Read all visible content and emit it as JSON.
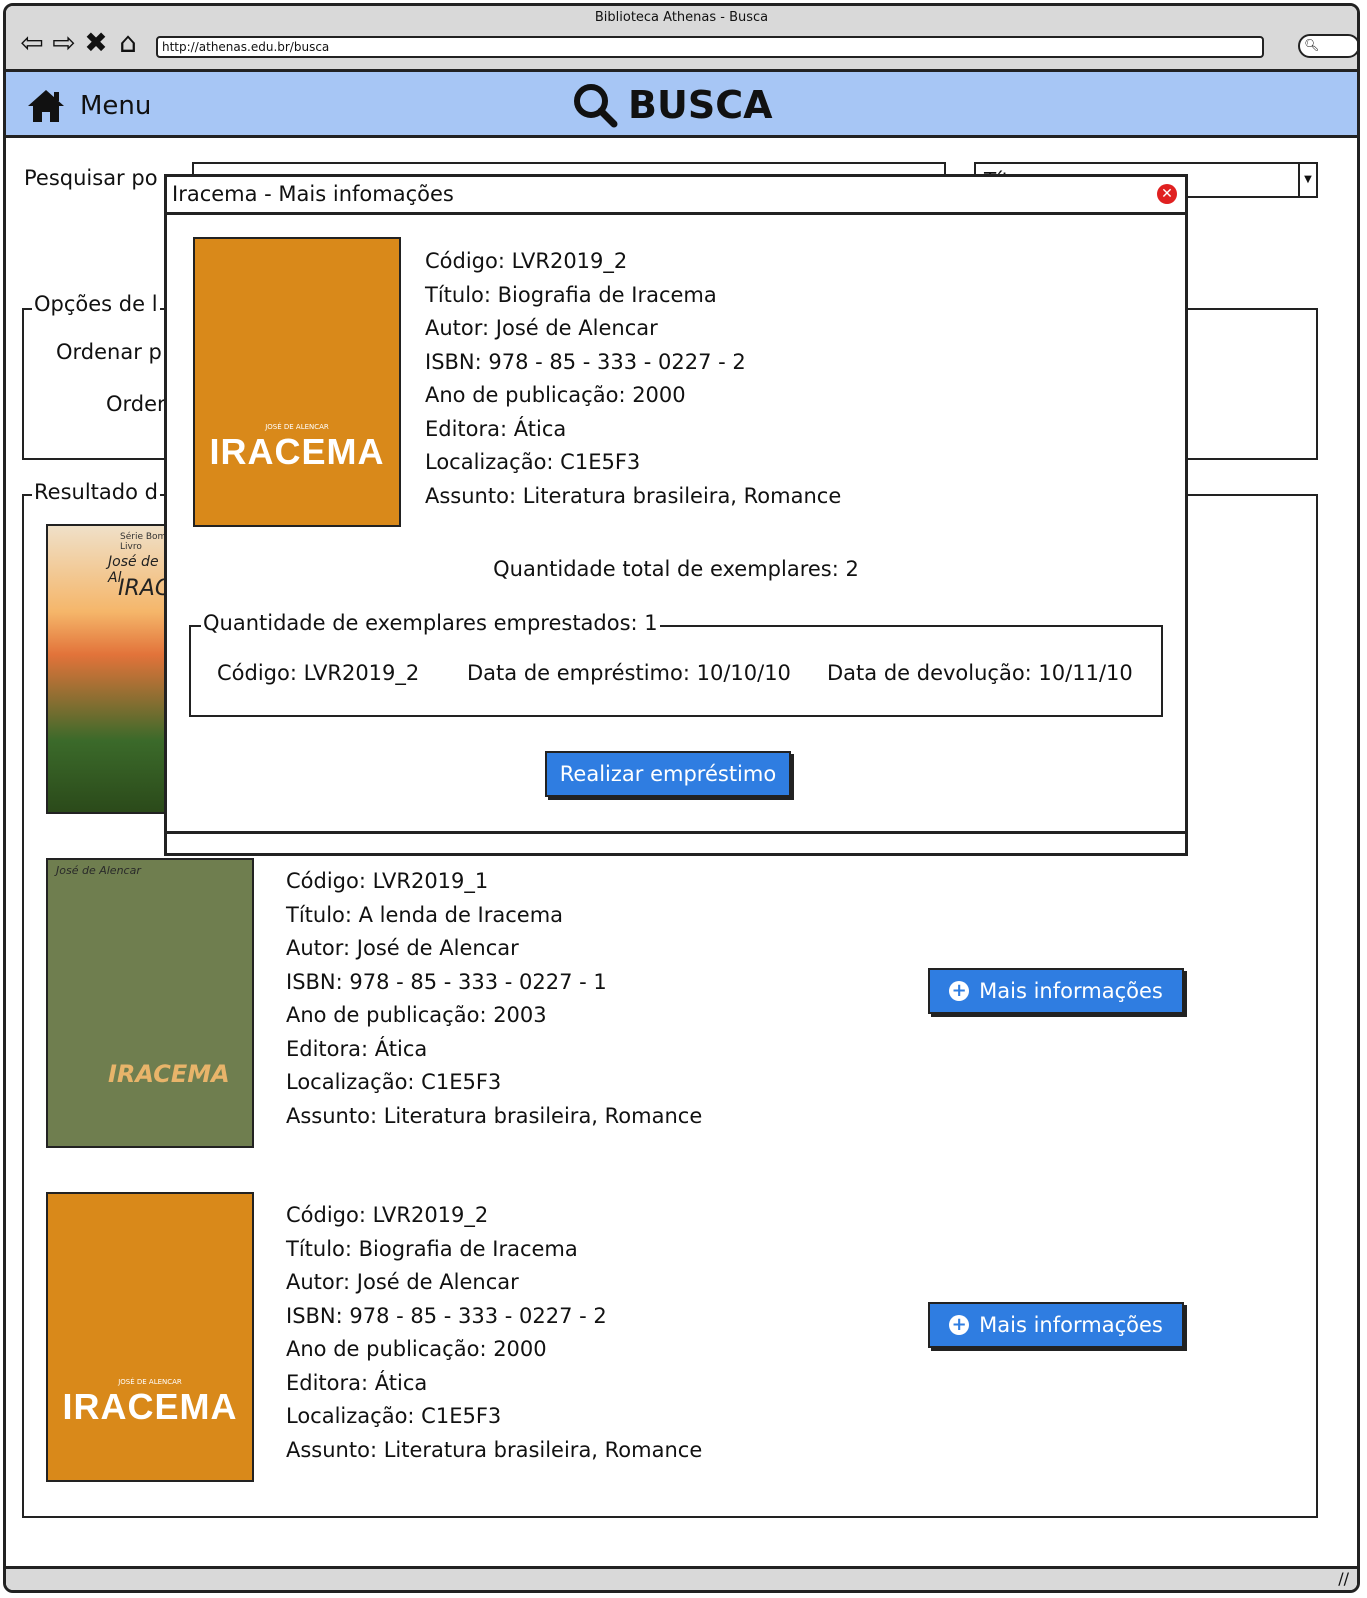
{
  "browser": {
    "title": "Biblioteca Athenas - Busca",
    "url": "http://athenas.edu.br/busca"
  },
  "header": {
    "menu_label": "Menu",
    "title": "BUSCA"
  },
  "search": {
    "label": "Pesquisar po",
    "select_value": "Tít"
  },
  "options": {
    "legend": "Opções de l",
    "order_by": "Ordenar p",
    "order": "Order"
  },
  "results": {
    "legend": "Resultado d",
    "items": [
      {
        "cover": {
          "series": "Série Bom Livro",
          "author": "José de Al",
          "title": "IRACE"
        }
      },
      {
        "cover": {
          "author": "José de Alencar",
          "title": "IRACEMA"
        },
        "lines": [
          "Código: LVR2019_1",
          "Título: A lenda de Iracema",
          "Autor: José de Alencar",
          "ISBN: 978 - 85 - 333 - 0227 - 1",
          "Ano de publicação: 2003",
          "Editora: Ática",
          "Localização: C1E5F3",
          "Assunto: Literatura brasileira, Romance"
        ],
        "button": "Mais informações"
      },
      {
        "cover": {
          "author": "JOSÉ DE ALENCAR",
          "title": "IRACEMA"
        },
        "lines": [
          "Código: LVR2019_2",
          "Título: Biografia de Iracema",
          "Autor: José de Alencar",
          "ISBN: 978 - 85 - 333 - 0227 - 2",
          "Ano de publicação: 2000",
          "Editora: Ática",
          "Localização: C1E5F3",
          "Assunto: Literatura brasileira, Romance"
        ],
        "button": "Mais informações"
      }
    ]
  },
  "modal": {
    "title": "Iracema - Mais infomações",
    "cover": {
      "author": "JOSÉ DE ALENCAR",
      "title": "IRACEMA"
    },
    "lines": [
      "Código: LVR2019_2",
      "Título: Biografia de Iracema",
      "Autor: José de Alencar",
      "ISBN: 978 - 85 - 333 - 0227 - 2",
      "Ano de publicação: 2000",
      "Editora: Ática",
      "Localização: C1E5F3",
      "Assunto: Literatura brasileira, Romance"
    ],
    "total": "Quantidade total de exemplares: 2",
    "loans_legend": "Quantidade de exemplares emprestados: 1",
    "loan": {
      "code": "Código: LVR2019_2",
      "loan_date": "Data de empréstimo: 10/10/10",
      "return_date": "Data de devolução: 10/11/10"
    },
    "action": "Realizar empréstimo"
  }
}
